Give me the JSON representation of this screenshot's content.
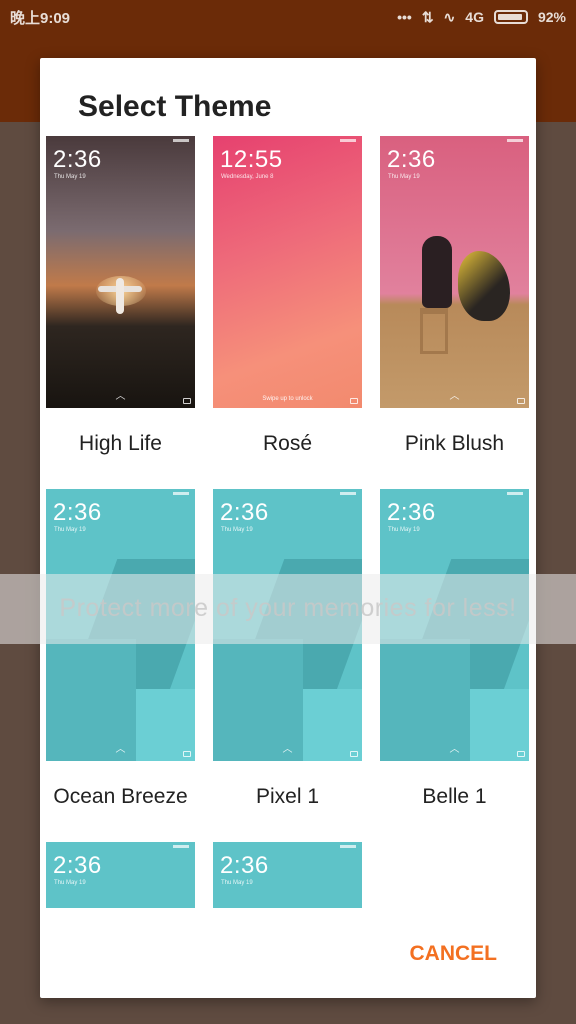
{
  "status_bar": {
    "time": "晚上9:09",
    "network": "4G",
    "battery_percent": "92%",
    "battery_level": 0.92,
    "icons": [
      "more-dots-icon",
      "data-arrows-icon",
      "activity-icon",
      "signal-icon",
      "battery-icon"
    ]
  },
  "dialog": {
    "title": "Select Theme",
    "cancel_label": "CANCEL",
    "accent_color": "#f37021"
  },
  "themes": [
    {
      "name": "High Life",
      "time": "2:36",
      "date": "Thu May 19"
    },
    {
      "name": "Rosé",
      "time": "12:55",
      "date": "Wednesday, June 8",
      "swipe": "Swipe up to unlock"
    },
    {
      "name": "Pink Blush",
      "time": "2:36",
      "date": "Thu May 19"
    },
    {
      "name": "Ocean Breeze",
      "time": "2:36",
      "date": "Thu May 19"
    },
    {
      "name": "Pixel 1",
      "time": "2:36",
      "date": "Thu May 19"
    },
    {
      "name": "Belle 1",
      "time": "2:36",
      "date": "Thu May 19"
    },
    {
      "name": "",
      "time": "2:36",
      "date": "Thu May 19"
    },
    {
      "name": "",
      "time": "2:36",
      "date": "Thu May 19"
    }
  ],
  "watermark": {
    "text": "Protect more of your memories for less!"
  }
}
